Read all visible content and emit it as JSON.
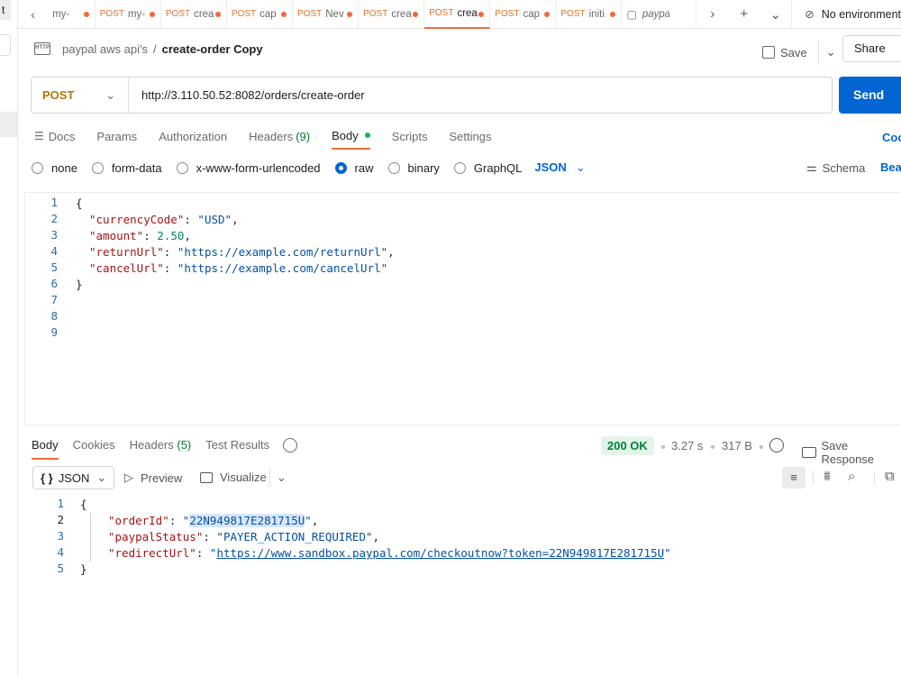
{
  "left": {
    "tab_letter": "t"
  },
  "tabs": [
    {
      "method": "",
      "name": "my-",
      "dot": true
    },
    {
      "method": "POST",
      "name": "my-",
      "dot": true
    },
    {
      "method": "POST",
      "name": "crea",
      "dot": true
    },
    {
      "method": "POST",
      "name": "cap",
      "dot": true
    },
    {
      "method": "POST",
      "name": "Nev",
      "dot": true
    },
    {
      "method": "POST",
      "name": "crea",
      "dot": true
    },
    {
      "method": "POST",
      "name": "crea",
      "dot": true,
      "active": true
    },
    {
      "method": "POST",
      "name": "cap",
      "dot": true
    },
    {
      "method": "POST",
      "name": "initi",
      "dot": true
    },
    {
      "method": "",
      "name": "paypa",
      "dot": false
    }
  ],
  "environment": {
    "label": "No environment"
  },
  "header": {
    "collection": "paypal aws api's",
    "separator": "/",
    "request_name": "create-order Copy",
    "http_icon": "HTTP",
    "save_label": "Save",
    "share_label": "Share"
  },
  "request": {
    "method": "POST",
    "url": "http://3.110.50.52:8082/orders/create-order",
    "send_label": "Send"
  },
  "request_tabs": [
    {
      "label": "Docs"
    },
    {
      "label": "Params"
    },
    {
      "label": "Authorization"
    },
    {
      "label": "Headers",
      "count": "(9)"
    },
    {
      "label": "Body",
      "active": true
    },
    {
      "label": "Scripts"
    },
    {
      "label": "Settings"
    }
  ],
  "cookies_label": "Coo",
  "body_types": [
    "none",
    "form-data",
    "x-www-form-urlencoded",
    "raw",
    "binary",
    "GraphQL"
  ],
  "body_type_selected": "raw",
  "body_format": "JSON",
  "schema_label": "Schema",
  "beautify_label": "Bea",
  "request_body": {
    "line_numbers": [
      "1",
      "2",
      "3",
      "4",
      "5",
      "6",
      "7",
      "8",
      "9"
    ],
    "open_brace": "{",
    "close_brace": "}",
    "currency_key": "\"currencyCode\"",
    "currency_val": "\"USD\"",
    "amount_key": "\"amount\"",
    "amount_val": "2.50",
    "return_key": "\"returnUrl\"",
    "return_val": "\"https://example.com/returnUrl\"",
    "cancel_key": "\"cancelUrl\"",
    "cancel_val": "\"https://example.com/cancelUrl\""
  },
  "response_tabs": [
    {
      "label": "Body",
      "active": true
    },
    {
      "label": "Cookies"
    },
    {
      "label": "Headers",
      "count": "(5)"
    },
    {
      "label": "Test Results"
    }
  ],
  "response_meta": {
    "status": "200 OK",
    "time": "3.27 s",
    "size": "317 B",
    "save_response": "Save Response"
  },
  "response_format": "JSON",
  "preview_label": "Preview",
  "visualize_label": "Visualize",
  "response_body": {
    "line_numbers": [
      "1",
      "2",
      "3",
      "4",
      "5"
    ],
    "open_brace": "{",
    "close_brace": "}",
    "order_key": "\"orderId\"",
    "order_val_q": "\"",
    "order_val": "22N949817E281715U",
    "status_key": "\"paypalStatus\"",
    "status_val": "\"PAYER_ACTION_REQUIRED\"",
    "redirect_key": "\"redirectUrl\"",
    "redirect_val": "https://www.sandbox.paypal.com/checkoutnow?token=22N949817E281715U"
  },
  "icons": {
    "tab_prev": "chevron-left-icon",
    "tab_next": "chevron-right-icon",
    "new_tab": "plus-icon",
    "tab_list": "chevron-down-icon",
    "no_env": "no-environment-icon",
    "history": "history-icon",
    "globe": "globe-icon",
    "wrap": "wrap-lines-icon",
    "filter": "filter-icon",
    "search": "search-icon",
    "copy": "copy-icon"
  },
  "colors": {
    "send_button": "#0265d2",
    "active_tab_underline": "#f26b3a",
    "method_post": "#ad7a03",
    "status_ok_bg": "#e3f5ea",
    "status_ok_text": "#007f31"
  }
}
